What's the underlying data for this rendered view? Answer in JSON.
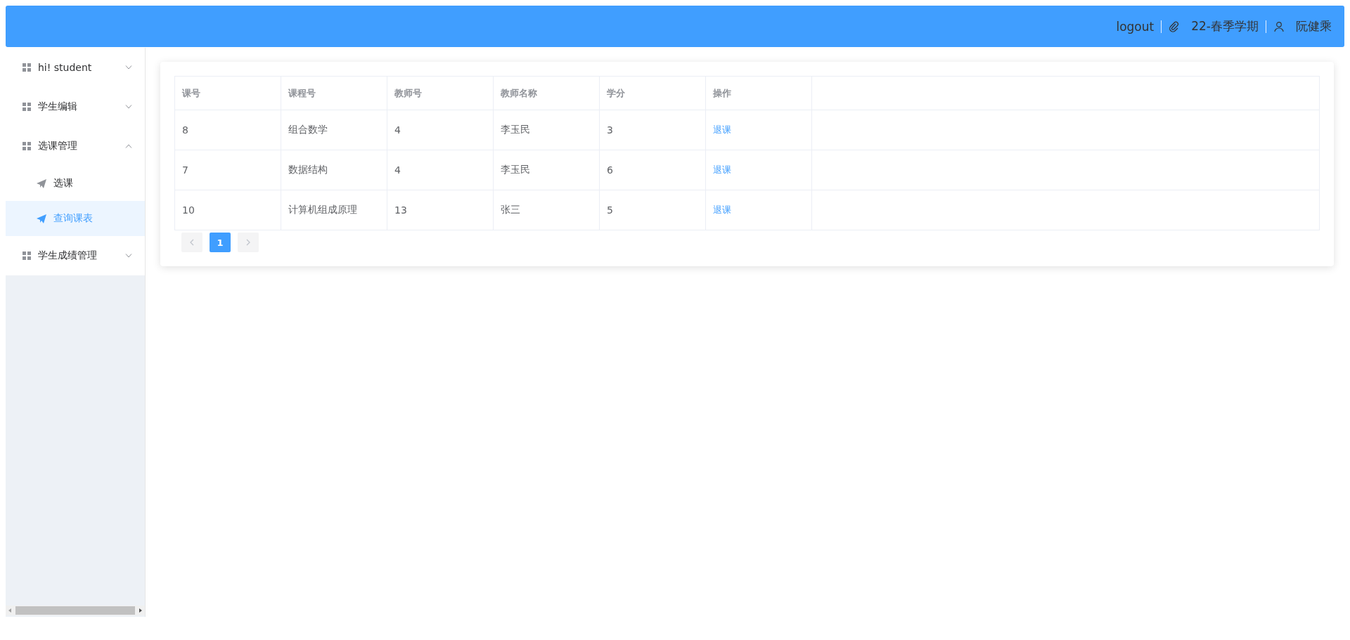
{
  "header": {
    "logout": "logout",
    "term": "22-春季学期",
    "user": "阮健乘"
  },
  "sidebar": {
    "items": [
      {
        "label": "hi! student",
        "expanded": false
      },
      {
        "label": "学生编辑",
        "expanded": false
      },
      {
        "label": "选课管理",
        "expanded": true,
        "children": [
          {
            "label": "选课",
            "selected": false
          },
          {
            "label": "查询课表",
            "selected": true
          }
        ]
      },
      {
        "label": "学生成绩管理",
        "expanded": false
      }
    ]
  },
  "table": {
    "columns": [
      "课号",
      "课程号",
      "教师号",
      "教师名称",
      "学分",
      "操作"
    ],
    "rows": [
      [
        "8",
        "组合数学",
        "4",
        "李玉民",
        "3",
        "退课"
      ],
      [
        "7",
        "数据结构",
        "4",
        "李玉民",
        "6",
        "退课"
      ],
      [
        "10",
        "计算机组成原理",
        "13",
        "张三",
        "5",
        "退课"
      ]
    ]
  },
  "pagination": {
    "pages": [
      {
        "label": "1",
        "selected": true
      }
    ]
  }
}
